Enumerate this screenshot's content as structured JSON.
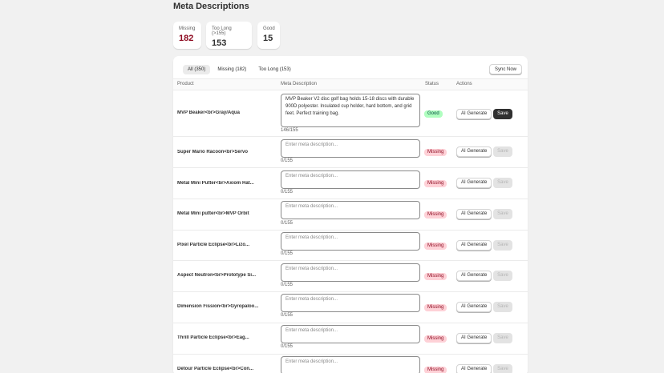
{
  "page": {
    "title": "Meta Descriptions"
  },
  "stats": [
    {
      "label": "Missing",
      "value": "182",
      "color": "#8e0b21"
    },
    {
      "label": "Too Long (>155)",
      "value": "153",
      "color": "#303030"
    },
    {
      "label": "Good",
      "value": "15",
      "color": "#303030"
    }
  ],
  "tabs": [
    {
      "label": "All (350)",
      "active": true
    },
    {
      "label": "Missing (182)",
      "active": false
    },
    {
      "label": "Too Long (153)",
      "active": false
    }
  ],
  "toolbar": {
    "sync_label": "Sync Now"
  },
  "columns": {
    "product": "Product",
    "meta": "Meta Description",
    "status": "Status",
    "actions": "Actions"
  },
  "placeholder": "Enter meta description...",
  "ai_label": "AI Generate",
  "save_label": "Save",
  "rows": [
    {
      "product": "MVP Beaker<br>Gray/Aqua",
      "meta": "MVP Beaker V2 disc golf bag holds 15-18 discs with durable 900D polyester. Insulated cup holder, hard bottom, and grid feet. Perfect training bag.",
      "count": "146/155",
      "status": "Good"
    },
    {
      "product": "Super Mario Racoon<br>Servo",
      "meta": "",
      "count": "0/155",
      "status": "Missing"
    },
    {
      "product": "Metal Mini Putter<br>Axiom Hat...",
      "meta": "",
      "count": "0/155",
      "status": "Missing"
    },
    {
      "product": "Metal Mini putter<br>MVP Orbit",
      "meta": "",
      "count": "0/155",
      "status": "Missing"
    },
    {
      "product": "Pixel Particle Eclipse<br>Lizo...",
      "meta": "",
      "count": "0/155",
      "status": "Missing"
    },
    {
      "product": "Aspect Neutron<br>Prototype Si...",
      "meta": "",
      "count": "0/155",
      "status": "Missing"
    },
    {
      "product": "Dimension Fission<br>Gyropaloo...",
      "meta": "",
      "count": "0/155",
      "status": "Missing"
    },
    {
      "product": "Thrill Particle Eclipse<br>Eag...",
      "meta": "",
      "count": "0/155",
      "status": "Missing"
    },
    {
      "product": "Detour Particle Eclipse<br>Con...",
      "meta": "",
      "count": "",
      "status": "Missing"
    }
  ]
}
